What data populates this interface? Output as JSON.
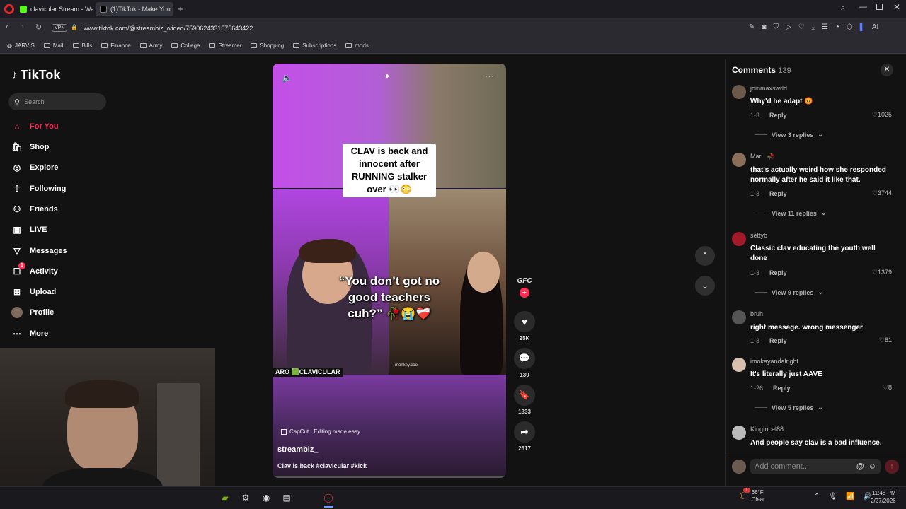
{
  "browser": {
    "tabs": [
      {
        "title": "clavicular Stream - Watch",
        "active": false
      },
      {
        "title": "(1)TikTok - Make Your",
        "active": true
      }
    ],
    "vpn_label": "VPN",
    "url": "www.tiktok.com/@streambiz_/video/7590624331575643422",
    "ai_label": "AI",
    "bookmarks": [
      "JARVIS",
      "Mail",
      "Bills",
      "Finance",
      "Army",
      "College",
      "Streamer",
      "Shopping",
      "Subscriptions",
      "mods"
    ]
  },
  "sidebar": {
    "logo": "TikTok",
    "search_placeholder": "Search",
    "items": [
      {
        "label": "For You",
        "icon": "home-icon",
        "active": true
      },
      {
        "label": "Shop",
        "icon": "shop-icon"
      },
      {
        "label": "Explore",
        "icon": "compass-icon"
      },
      {
        "label": "Following",
        "icon": "following-icon"
      },
      {
        "label": "Friends",
        "icon": "friends-icon"
      },
      {
        "label": "LIVE",
        "icon": "live-icon"
      },
      {
        "label": "Messages",
        "icon": "messages-icon"
      },
      {
        "label": "Activity",
        "icon": "activity-icon",
        "badge": "1"
      },
      {
        "label": "Upload",
        "icon": "upload-icon"
      },
      {
        "label": "Profile",
        "icon": "profile-icon"
      },
      {
        "label": "More",
        "icon": "more-icon"
      }
    ]
  },
  "video": {
    "top_caption": "CLAV is back and innocent after RUNNING stalker over 👀😳",
    "top_caption_lines": [
      "CLAV is back and",
      "innocent after",
      "RUNNING stalker",
      "over 👀😳"
    ],
    "mid_caption_lines": [
      "“You don’t got no",
      "good teachers",
      "cuh?” 🥀😭❤️‍🩹"
    ],
    "stream_tag": "ARO 🟩CLAVICULAR",
    "watermark": "monkey.cool",
    "capcut_label": "CapCut · Editing made easy",
    "author": "streambiz_",
    "description": "Clav is back #clavicular #kick",
    "actions": {
      "likes": "25K",
      "comments": "139",
      "saves": "1833",
      "shares": "2617"
    },
    "creator_badge": "GFC"
  },
  "comments_panel": {
    "title": "Comments",
    "count": "139",
    "add_placeholder": "Add comment...",
    "comments": [
      {
        "user": "joinmaxswrld",
        "text": "Why'd he adapt 😡",
        "date": "1-3",
        "reply": "Reply",
        "likes": "1025",
        "view_replies": "View 3 replies"
      },
      {
        "user": "Maru 🥀",
        "text": "that's actually weird how she responded normally after he said it like that.",
        "date": "1-3",
        "reply": "Reply",
        "likes": "3744",
        "view_replies": "View 11 replies"
      },
      {
        "user": "settyb",
        "text": "Classic clav educating the youth well done",
        "date": "1-3",
        "reply": "Reply",
        "likes": "1379",
        "view_replies": "View 9 replies"
      },
      {
        "user": "bruh",
        "text": "right message. wrong messenger",
        "date": "1-3",
        "reply": "Reply",
        "likes": "81",
        "view_replies": ""
      },
      {
        "user": "imokayandalright",
        "text": "It's literally just AAVE",
        "date": "1-26",
        "reply": "Reply",
        "likes": "8",
        "view_replies": "View 5 replies"
      },
      {
        "user": "KingIncel88",
        "text": "And people say clav is a bad influence.",
        "date": "",
        "reply": "",
        "likes": "",
        "view_replies": ""
      }
    ]
  },
  "taskbar": {
    "weather_temp": "66°F",
    "weather_desc": "Clear",
    "time": "11:48 PM",
    "date": "2/27/2026",
    "notification_badge": "1"
  },
  "colors": {
    "accent": "#fe2c55",
    "background": "#121212"
  }
}
